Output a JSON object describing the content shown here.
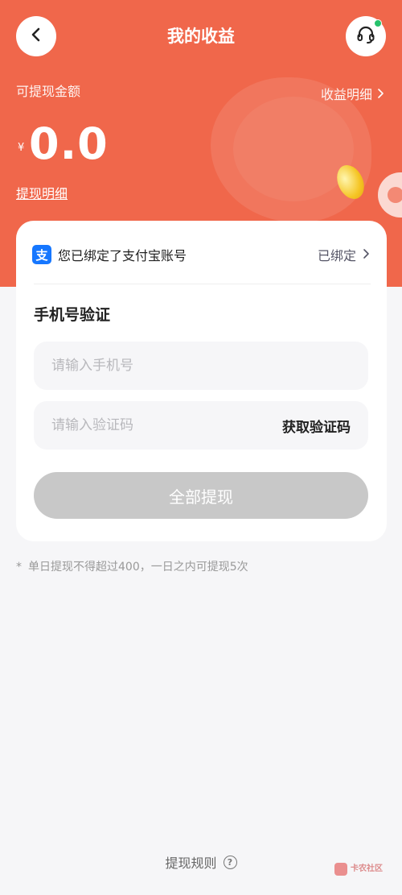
{
  "header": {
    "title": "我的收益"
  },
  "earnings": {
    "available_label": "可提现金额",
    "detail_link": "收益明细",
    "currency_symbol": "¥",
    "amount": "0.0",
    "withdraw_detail_link": "提现明细"
  },
  "card": {
    "alipay_text": "您已绑定了支付宝账号",
    "alipay_icon_char": "支",
    "bound_status": "已绑定",
    "section_title": "手机号验证",
    "phone_placeholder": "请输入手机号",
    "code_placeholder": "请输入验证码",
    "get_code_label": "获取验证码",
    "submit_label": "全部提现"
  },
  "note": {
    "bullet": "*",
    "text": "单日提现不得超过400，一日之内可提现5次"
  },
  "footer": {
    "rules_label": "提现规则",
    "help_char": "?"
  },
  "watermark": {
    "text": "卡农社区"
  },
  "colors": {
    "hero_bg": "#f0674b",
    "alipay_blue": "#1677ff",
    "disabled_button": "#c8c8c8",
    "online_dot": "#27c26c"
  },
  "icons": {
    "back": "chevron-left-icon",
    "service": "headset-icon",
    "detail_arrow": "chevron-right-icon",
    "bound_arrow": "chevron-right-icon",
    "help": "question-circle-icon"
  }
}
